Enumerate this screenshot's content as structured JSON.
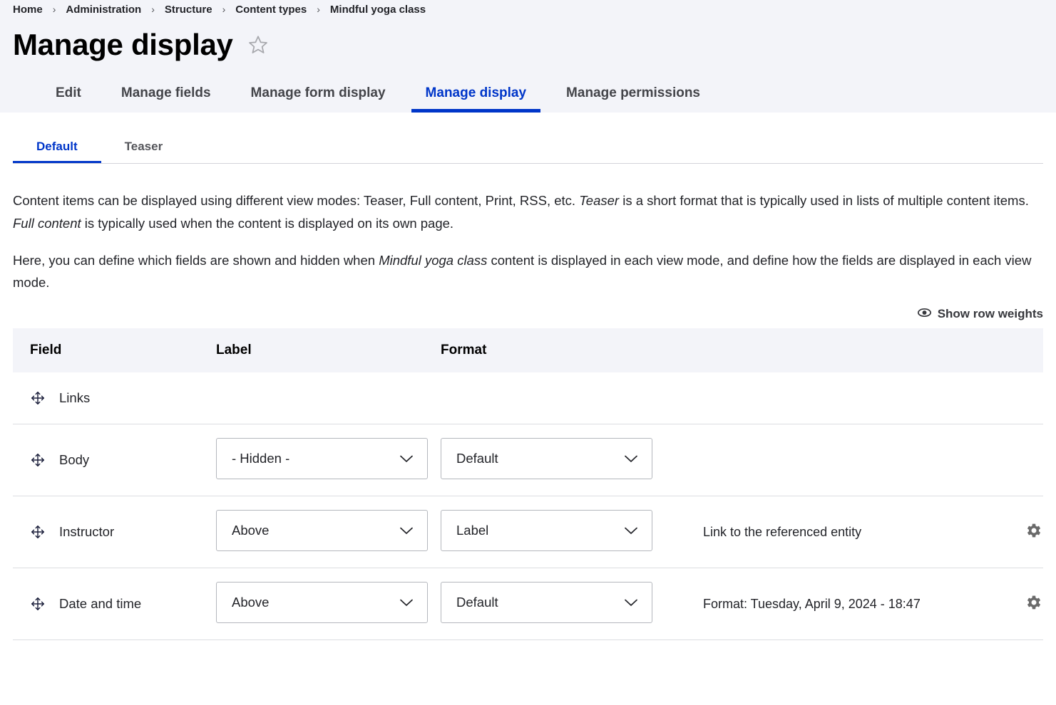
{
  "breadcrumb": {
    "separator": "›",
    "items": [
      {
        "label": "Home"
      },
      {
        "label": "Administration"
      },
      {
        "label": "Structure"
      },
      {
        "label": "Content types"
      },
      {
        "label": "Mindful yoga class"
      }
    ]
  },
  "header": {
    "title": "Manage display",
    "star_icon": "star-outline-icon"
  },
  "primary_tabs": [
    {
      "label": "Edit",
      "active": false
    },
    {
      "label": "Manage fields",
      "active": false
    },
    {
      "label": "Manage form display",
      "active": false
    },
    {
      "label": "Manage display",
      "active": true
    },
    {
      "label": "Manage permissions",
      "active": false
    }
  ],
  "secondary_tabs": [
    {
      "label": "Default",
      "active": true
    },
    {
      "label": "Teaser",
      "active": false
    }
  ],
  "description": {
    "paragraph1_part1": "Content items can be displayed using different view modes: Teaser, Full content, Print, RSS, etc. ",
    "paragraph1_em1": "Teaser",
    "paragraph1_part2": " is a short format that is typically used in lists of multiple content items. ",
    "paragraph1_em2": "Full content",
    "paragraph1_part3": " is typically used when the content is displayed on its own page.",
    "paragraph2_part1": "Here, you can define which fields are shown and hidden when ",
    "paragraph2_em1": "Mindful yoga class",
    "paragraph2_part2": " content is displayed in each view mode, and define how the fields are displayed in each view mode."
  },
  "row_weights": {
    "label": "Show row weights",
    "icon": "eye-icon"
  },
  "table": {
    "columns": {
      "field": "Field",
      "label": "Label",
      "format": "Format",
      "summary": "",
      "settings": ""
    },
    "rows": [
      {
        "field": "Links",
        "drag_icon": "move-icon",
        "has_selects": false,
        "label_value": "",
        "format_value": "",
        "summary": "",
        "has_gear": false
      },
      {
        "field": "Body",
        "drag_icon": "move-icon",
        "has_selects": true,
        "label_value": "- Hidden -",
        "format_value": "Default",
        "summary": "",
        "has_gear": false
      },
      {
        "field": "Instructor",
        "drag_icon": "move-icon",
        "has_selects": true,
        "label_value": "Above",
        "format_value": "Label",
        "summary": "Link to the referenced entity",
        "has_gear": true
      },
      {
        "field": "Date and time",
        "drag_icon": "move-icon",
        "has_selects": true,
        "label_value": "Above",
        "format_value": "Default",
        "summary": "Format: Tuesday, April 9, 2024 - 18:47",
        "has_gear": true
      }
    ]
  },
  "colors": {
    "accent": "#0036c9",
    "header_band": "#f3f4f9",
    "text": "#232429",
    "border": "#b4b7bd",
    "gear": "#6a6a6a"
  }
}
